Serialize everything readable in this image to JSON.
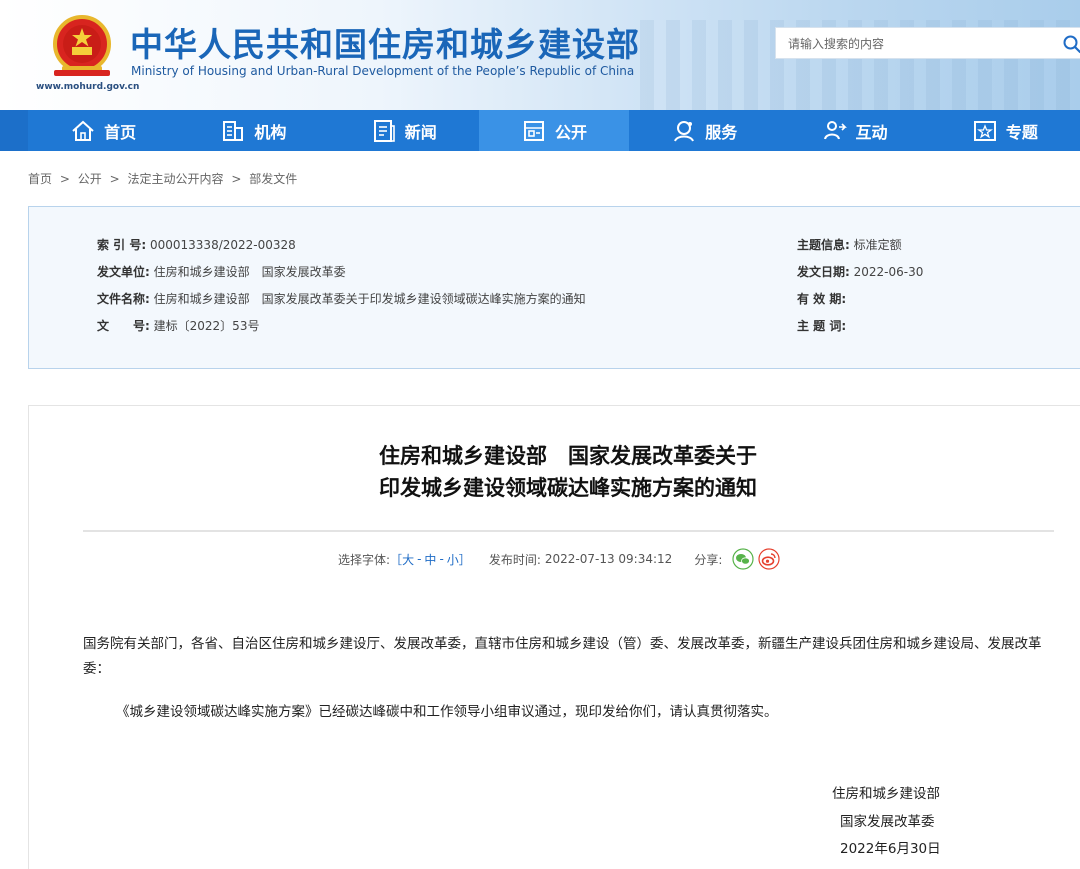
{
  "header": {
    "title_cn": "中华人民共和国住房和城乡建设部",
    "title_en": "Ministry of Housing and Urban-Rural Development of the People’s Republic of China",
    "url": "www.mohurd.gov.cn",
    "search_placeholder": "请输入搜索的内容"
  },
  "nav": {
    "items": [
      {
        "label": "首页",
        "icon": "home-icon"
      },
      {
        "label": "机构",
        "icon": "building-icon"
      },
      {
        "label": "新闻",
        "icon": "news-icon"
      },
      {
        "label": "公开",
        "icon": "open-icon",
        "active": true
      },
      {
        "label": "服务",
        "icon": "service-icon"
      },
      {
        "label": "互动",
        "icon": "interact-icon"
      },
      {
        "label": "专题",
        "icon": "topic-icon"
      }
    ]
  },
  "breadcrumb": [
    "首页",
    ">",
    "公开",
    ">",
    "法定主动公开内容",
    ">",
    "部发文件"
  ],
  "meta": {
    "index_label": "索 引 号:",
    "index_value": "000013338/2022-00328",
    "unit_label": "发文单位:",
    "unit_value": "住房和城乡建设部　国家发展改革委",
    "name_label": "文件名称:",
    "name_value": "住房和城乡建设部　国家发展改革委关于印发城乡建设领域碳达峰实施方案的通知",
    "doc_label": "文　　号:",
    "doc_value": "建标〔2022〕53号",
    "topic_label": "主题信息:",
    "topic_value": "标准定额",
    "date_label": "发文日期:",
    "date_value": "2022-06-30",
    "valid_label": "有 效 期:",
    "valid_value": "",
    "keyword_label": "主 题 词:",
    "keyword_value": ""
  },
  "article": {
    "title_line1": "住房和城乡建设部　国家发展改革委关于",
    "title_line2": "印发城乡建设领域碳达峰实施方案的通知",
    "font_label": "选择字体:",
    "font_open": "［",
    "font_large": "大",
    "font_sep1": "-",
    "font_mid": "中",
    "font_sep2": "-",
    "font_small": "小",
    "font_close": "］",
    "publish_label": "发布时间:",
    "publish_time": "2022-07-13 09:34:12",
    "share_label": "分享:",
    "para1": "国务院有关部门，各省、自治区住房和城乡建设厅、发展改革委，直辖市住房和城乡建设（管）委、发展改革委，新疆生产建设兵团住房和城乡建设局、发展改革委：",
    "para2": "《城乡建设领域碳达峰实施方案》已经碳达峰碳中和工作领导小组审议通过，现印发给你们，请认真贯彻落实。",
    "sig1": "住房和城乡建设部",
    "sig2": "国家发展改革委",
    "sig3": "2022年6月30日"
  },
  "colors": {
    "brand_blue": "#1a66b8",
    "nav_blue": "#1f78d4",
    "nav_active": "#3a92e6",
    "link_blue": "#1f6cc6"
  }
}
